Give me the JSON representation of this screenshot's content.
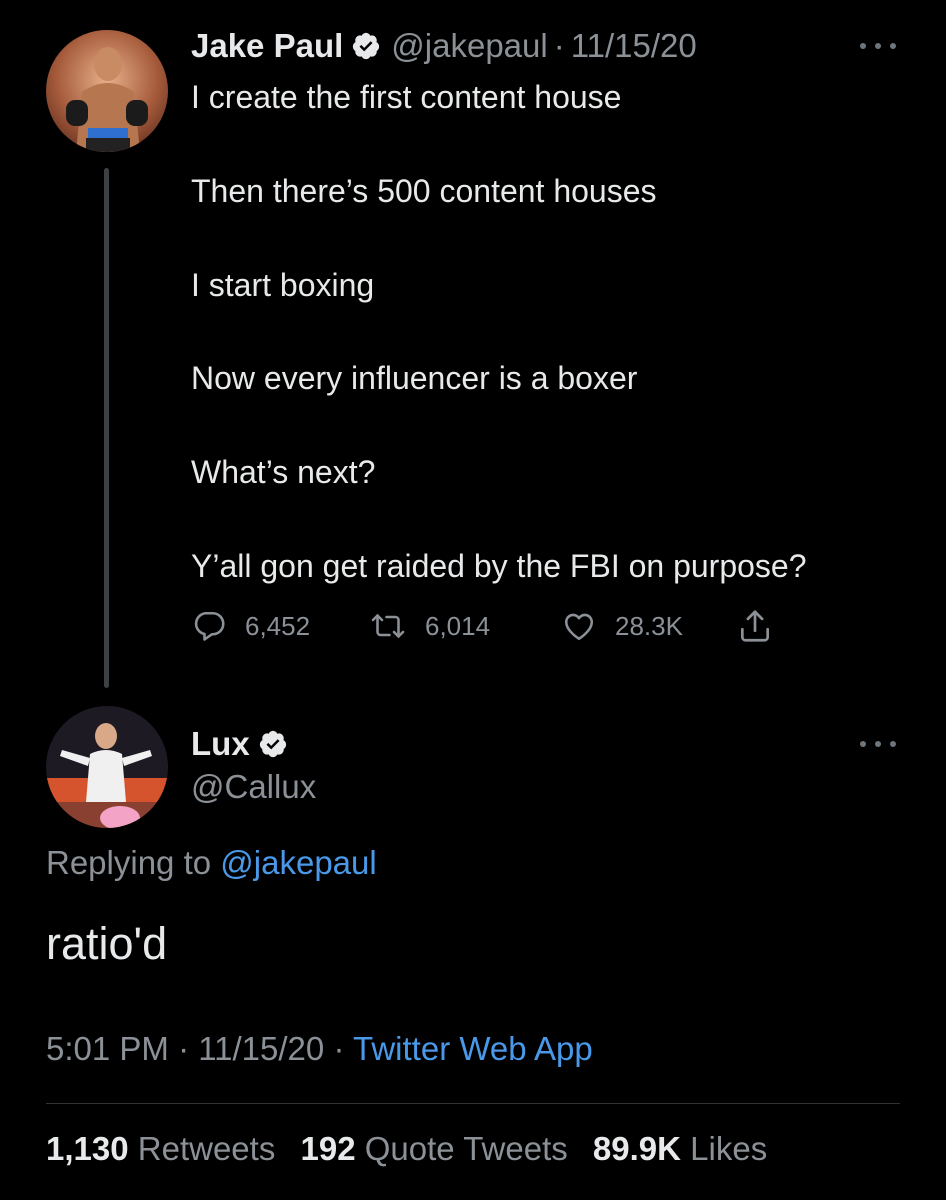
{
  "parent": {
    "name": "Jake Paul",
    "handle": "@jakepaul",
    "separator": "·",
    "date": "11/15/20",
    "lines": [
      "I create the first content house",
      "Then there’s 500 content houses",
      "I start boxing",
      "Now every influencer is a boxer",
      "What’s next?",
      "Y’all gon get raided by the FBI on purpose?"
    ],
    "actions": {
      "replies": "6,452",
      "retweets": "6,014",
      "likes": "28.3K"
    },
    "avatar_icon": "boxer-avatar-photo"
  },
  "reply": {
    "name": "Lux",
    "handle": "@Callux",
    "replying_prefix": "Replying to",
    "replying_to": "@jakepaul",
    "text": "ratio'd",
    "time": "5:01 PM",
    "separator": "·",
    "date": "11/15/20",
    "source": "Twitter Web App",
    "stats": {
      "retweets_count": "1,130",
      "retweets_label": "Retweets",
      "quotes_count": "192",
      "quotes_label": "Quote Tweets",
      "likes_count": "89.9K",
      "likes_label": "Likes"
    },
    "avatar_icon": "user-avatar-photo"
  },
  "colors": {
    "background": "#000000",
    "text": "#e7e9ea",
    "secondary": "#8b9196",
    "link": "#4a99e9",
    "thread_line": "#3e4144",
    "divider": "#2f3336"
  },
  "icons": {
    "verified": "verified-badge-icon",
    "more": "more-options-icon",
    "reply": "reply-icon",
    "retweet": "retweet-icon",
    "like": "heart-icon",
    "share": "share-icon"
  }
}
